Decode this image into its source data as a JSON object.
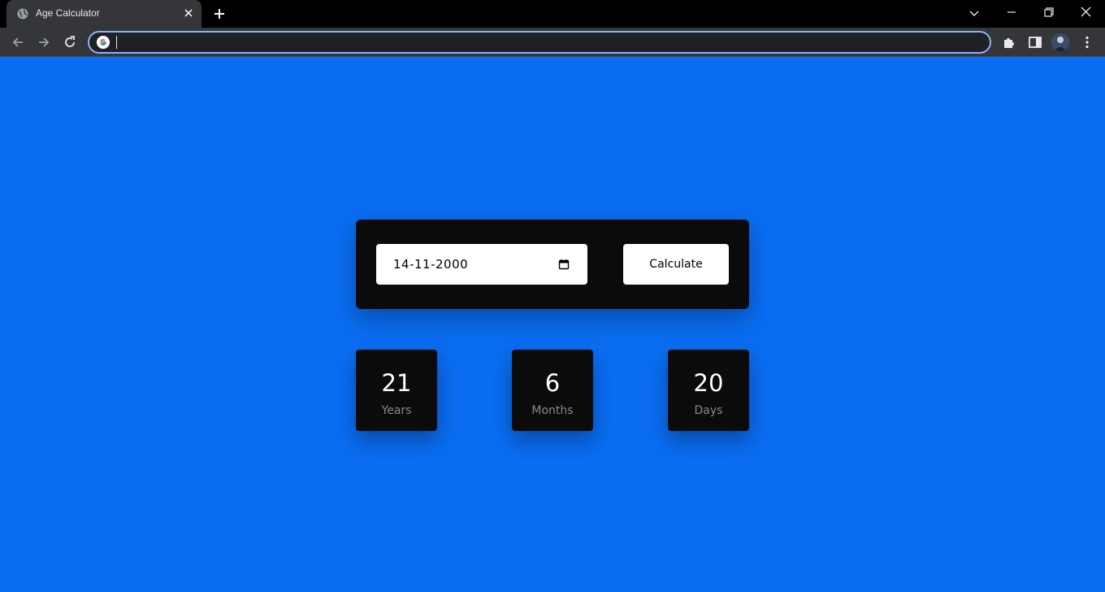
{
  "browser": {
    "tab_title": "Age Calculator",
    "address_value": ""
  },
  "calculator": {
    "date_value": "14-11-2000",
    "button_label": "Calculate"
  },
  "results": [
    {
      "value": "21",
      "label": "Years"
    },
    {
      "value": "6",
      "label": "Months"
    },
    {
      "value": "20",
      "label": "Days"
    }
  ],
  "colors": {
    "page_background": "#0a6cf0",
    "card_background": "#0b0b0b",
    "label_gray": "#8a8a8a"
  }
}
